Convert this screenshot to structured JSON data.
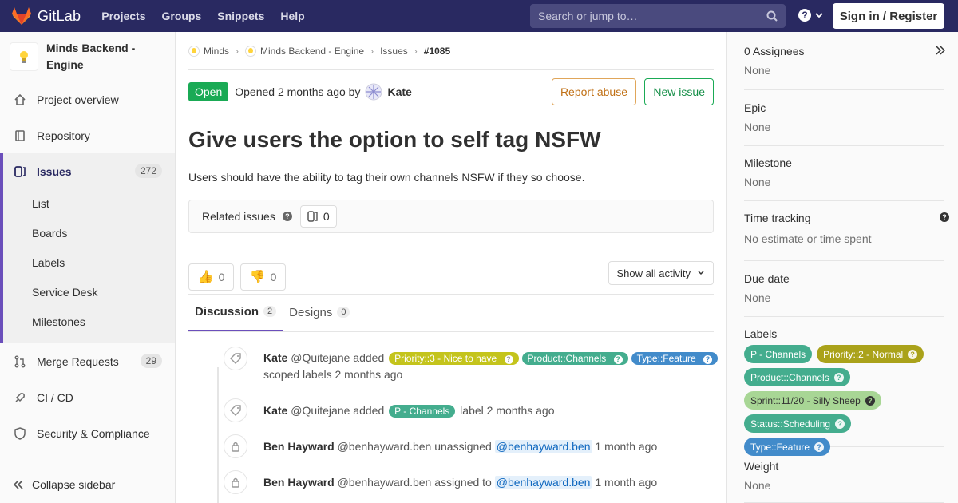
{
  "navbar": {
    "brand": "GitLab",
    "links": [
      "Projects",
      "Groups",
      "Snippets",
      "Help"
    ],
    "search_placeholder": "Search or jump to…",
    "signin": "Sign in / Register"
  },
  "sidebar": {
    "project_name": "Minds Backend - Engine",
    "items": [
      {
        "label": "Project overview"
      },
      {
        "label": "Repository"
      },
      {
        "label": "Issues",
        "count": "272"
      },
      {
        "label": "Merge Requests",
        "count": "29"
      },
      {
        "label": "CI / CD"
      },
      {
        "label": "Security & Compliance"
      }
    ],
    "sub_items": [
      "List",
      "Boards",
      "Labels",
      "Service Desk",
      "Milestones"
    ],
    "collapse": "Collapse sidebar"
  },
  "breadcrumbs": [
    "Minds",
    "Minds Backend - Engine",
    "Issues",
    "#1085"
  ],
  "issue": {
    "status": "Open",
    "opened_text": "Opened 2 months ago by",
    "author": "Kate",
    "report_abuse": "Report abuse",
    "new_issue": "New issue",
    "title": "Give users the option to self tag NSFW",
    "description": "Users should have the ability to tag their own channels NSFW if they so choose.",
    "related_label": "Related issues",
    "related_count": "0",
    "thumbs_up": "0",
    "thumbs_down": "0",
    "activity_filter": "Show all activity"
  },
  "tabs": [
    {
      "label": "Discussion",
      "count": "2"
    },
    {
      "label": "Designs",
      "count": "0"
    }
  ],
  "notes": [
    {
      "author": "Kate",
      "handle": "@Quitejane",
      "action": "added",
      "labels": [
        "Priority::3 - Nice to have",
        "Product::Channels",
        "Type::Feature"
      ],
      "suffix": "scoped labels 2 months ago"
    },
    {
      "author": "Kate",
      "handle": "@Quitejane",
      "action": "added",
      "labels": [
        "P - Channels"
      ],
      "suffix": "label 2 months ago"
    },
    {
      "author": "Ben Hayward",
      "handle": "@benhayward.ben",
      "action": "unassigned",
      "mention": "@benhayward.ben",
      "time": "1 month ago"
    },
    {
      "author": "Ben Hayward",
      "handle": "@benhayward.ben",
      "action": "assigned to",
      "mention": "@benhayward.ben",
      "time": "1 month ago"
    }
  ],
  "right_sidebar": {
    "assignees_title": "0 Assignees",
    "assignees_value": "None",
    "epic_title": "Epic",
    "epic_value": "None",
    "milestone_title": "Milestone",
    "milestone_value": "None",
    "time_title": "Time tracking",
    "time_value": "No estimate or time spent",
    "due_title": "Due date",
    "due_value": "None",
    "labels_title": "Labels",
    "labels": [
      {
        "text": "P - Channels",
        "color": "#44ad8e"
      },
      {
        "text": "Priority::2 - Normal",
        "color": "#aaa21a"
      },
      {
        "text": "Product::Channels",
        "color": "#44ad8e"
      },
      {
        "text": "Sprint::11/20 - Silly Sheep",
        "color": "#a8d695"
      },
      {
        "text": "Status::Scheduling",
        "color": "#44ad8e"
      },
      {
        "text": "Type::Feature",
        "color": "#428bca"
      }
    ],
    "weight_title": "Weight",
    "weight_value": "None"
  },
  "colors": {
    "navbar": "#292961",
    "accent": "#6b4fbb",
    "open": "#1aaa55",
    "label_priority3": "#c4c41c",
    "label_product": "#44ad8e",
    "label_type": "#428bca"
  }
}
